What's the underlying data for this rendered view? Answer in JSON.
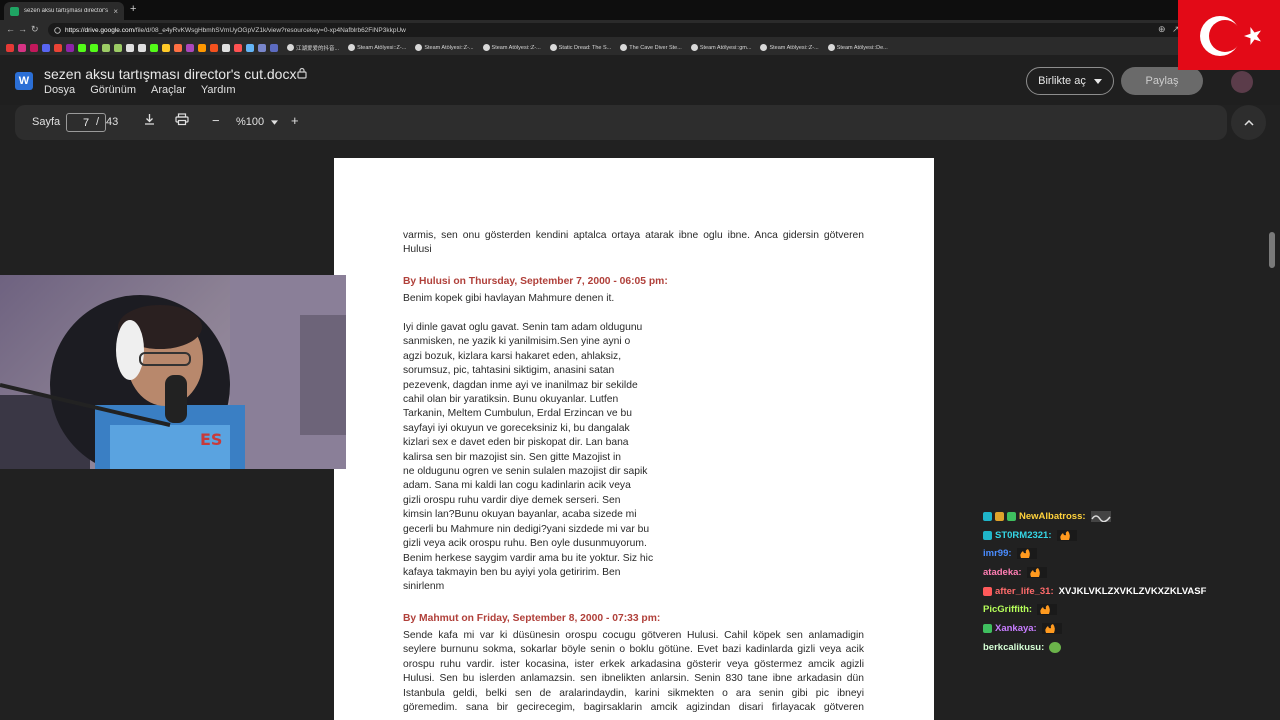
{
  "browser": {
    "tab_title": "sezen aksu tartışması director's cu...",
    "tab_close": "×",
    "newtab": "+",
    "url_host": "https://drive.google.com",
    "url_path": "/file/d/08_e4yRvKWsgHbmhSVmUyOGpVZ1k/view?resourcekey=0-xp4Nafblrb62FiNP3kkpUw",
    "bookmarks": [
      {
        "label": "江湖爱爱的抖音..."
      },
      {
        "label": "Steam Atölyesi::Z-..."
      },
      {
        "label": "Steam Atölyesi::Z-..."
      },
      {
        "label": "Steam Atölyesi::Z-..."
      },
      {
        "label": "Static Dread: The S..."
      },
      {
        "label": "The Cave Diver Ste..."
      },
      {
        "label": "Steam Atölyesi::gm..."
      },
      {
        "label": "Steam Atölyesi::Z-..."
      },
      {
        "label": "Steam Atölyesi::De..."
      }
    ]
  },
  "doc": {
    "title": "sezen aksu tartışması director's cut.docx",
    "menu": [
      "Dosya",
      "Görünüm",
      "Araçlar",
      "Yardım"
    ],
    "open_with": "Birlikte aç",
    "share": "Paylaş"
  },
  "toolbar": {
    "page_label": "Sayfa",
    "page_current": "7",
    "page_sep": "/",
    "page_total": "43",
    "zoom": "%100"
  },
  "content": {
    "p1": [
      "varmis, sen onu gösterden kendini aptalca ortaya atarak ibne oglu ibne. Anca gidersin götveren",
      "Hulusi"
    ],
    "h1": "By Hulusi on Thursday, September 7, 2000 - 06:05 pm:",
    "p2": [
      "Benim kopek gibi havlayan Mahmure denen it."
    ],
    "p3": [
      "Iyi dinle gavat oglu gavat. Senin tam adam oldugunu",
      "sanmisken, ne yazik ki yanilmisim.Sen yine ayni o",
      "agzi bozuk, kizlara karsi hakaret eden, ahlaksiz,",
      "sorumsuz, pic, tahtasini siktigim, anasini satan",
      "pezevenk, dagdan inme ayi ve inanilmaz bir sekilde",
      "cahil olan bir yaratiksin. Bunu okuyanlar. Lutfen",
      "Tarkanin, Meltem Cumbulun, Erdal Erzincan ve bu",
      "sayfayi iyi okuyun ve goreceksiniz ki, bu dangalak",
      "kizlari sex e davet eden bir piskopat dir. Lan bana",
      "kalirsa sen bir mazojist sin. Sen gitte Mazojist in",
      "ne oldugunu ogren ve senin sulalen mazojist dir sapik",
      "adam. Sana mi kaldi lan cogu kadinlarin acik veya",
      "gizli orospu ruhu vardir diye demek serseri. Sen",
      "kimsin lan?Bunu okuyan bayanlar, acaba sizede mi",
      "gecerli bu Mahmure nin dedigi?yani sizdede mi var bu",
      "gizli veya acik orospu ruhu. Ben oyle dusunmuyorum.",
      "Benim herkese saygim vardir ama bu ite yoktur. Siz hic",
      "kafaya takmayin ben bu ayiyi yola getiririm. Ben",
      "sinirlenm"
    ],
    "h2": "By Mahmut on Friday, September 8, 2000 - 07:33 pm:",
    "p4": [
      "Sende kafa mi var ki düsünesin orospu cocugu götveren Hulusi. Cahil köpek sen anlamadigin",
      "seylere burnunu sokma, sokarlar böyle senin o boklu götüne. Evet bazi kadinlarda gizli veya acik",
      "orospu ruhu vardir. ister kocasina, ister erkek arkadasina gösterir veya göstermez amcik agizli",
      "Hulusi. Sen bu islerden anlamazsin. sen ibnelikten anlarsin. Senin 830 tane ibne arkadasin dün",
      "Istanbula geldi, belki sen de aralarindaydin, karini sikmekten o ara senin gibi pic ibneyi",
      "göremedim. sana bir gecirecegim, bagirsaklarin amcik agizindan disari firlayacak götveren"
    ]
  },
  "chat": [
    {
      "user": "NewAlbatross:",
      "color": "#ffd23c",
      "msg": "",
      "badges": [
        "#1fb5c9",
        "#e0a32a",
        "#3fbf5f"
      ],
      "emote": "wavy"
    },
    {
      "user": "ST0RM2321:",
      "color": "#35d6e6",
      "msg": "",
      "badges": [
        "#1fb5c9"
      ],
      "emote": "fire"
    },
    {
      "user": "imr99:",
      "color": "#4a8cff",
      "msg": "",
      "badges": [],
      "emote": "fire"
    },
    {
      "user": "atadeka:",
      "color": "#ff7eb3",
      "msg": "",
      "badges": [],
      "emote": "fire"
    },
    {
      "user": "after_life_31:",
      "color": "#ff6b6b",
      "msg": "XVJKLVKLZXVKLZVKXZKLVASF",
      "badges": [
        "#ff5a5a"
      ],
      "emote": ""
    },
    {
      "user": "PicGriffith:",
      "color": "#b6ff5a",
      "msg": "",
      "badges": [],
      "emote": "fire"
    },
    {
      "user": "Xankaya:",
      "color": "#c77dff",
      "msg": "",
      "badges": [
        "#3fbf5f"
      ],
      "emote": "fire"
    },
    {
      "user": "berkcalikusu:",
      "color": "#d6ffd6",
      "msg": "",
      "badges": [],
      "emote": "frog"
    }
  ],
  "colors": {
    "accent_heading": "#b0403a",
    "flag_red": "#e30a17"
  }
}
